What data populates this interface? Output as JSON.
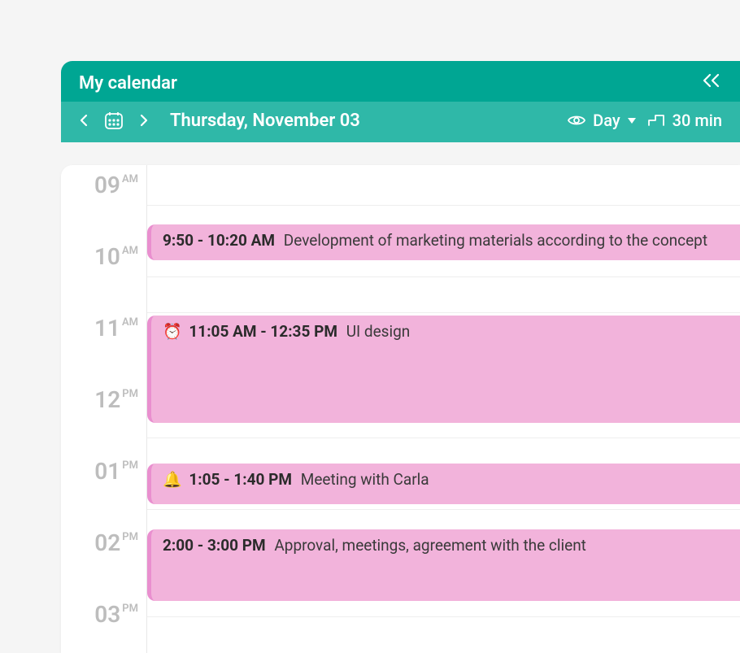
{
  "header": {
    "title": "My calendar",
    "date_label": "Thursday, November 03",
    "view_label": "Day",
    "interval_label": "30 min"
  },
  "colors": {
    "header_bg": "#00a693",
    "subheader_bg": "#2fb8a8",
    "event_bg": "#f2b3db",
    "event_border": "#e98fcf"
  },
  "hours": [
    {
      "num": "09",
      "ampm": "AM"
    },
    {
      "num": "10",
      "ampm": "AM"
    },
    {
      "num": "11",
      "ampm": "AM"
    },
    {
      "num": "12",
      "ampm": "PM"
    },
    {
      "num": "01",
      "ampm": "PM"
    },
    {
      "num": "02",
      "ampm": "PM"
    },
    {
      "num": "03",
      "ampm": "PM"
    }
  ],
  "events": [
    {
      "emoji": "",
      "time": "9:50 - 10:20 AM",
      "desc": "Development of marketing materials according to the concept"
    },
    {
      "emoji": "⏰",
      "time": "11:05 AM - 12:35 PM",
      "desc": "UI design"
    },
    {
      "emoji": "🔔",
      "time": "1:05 - 1:40 PM",
      "desc": "Meeting with Carla"
    },
    {
      "emoji": "",
      "time": "2:00 - 3:00 PM",
      "desc": "Approval, meetings, agreement with the client"
    }
  ]
}
